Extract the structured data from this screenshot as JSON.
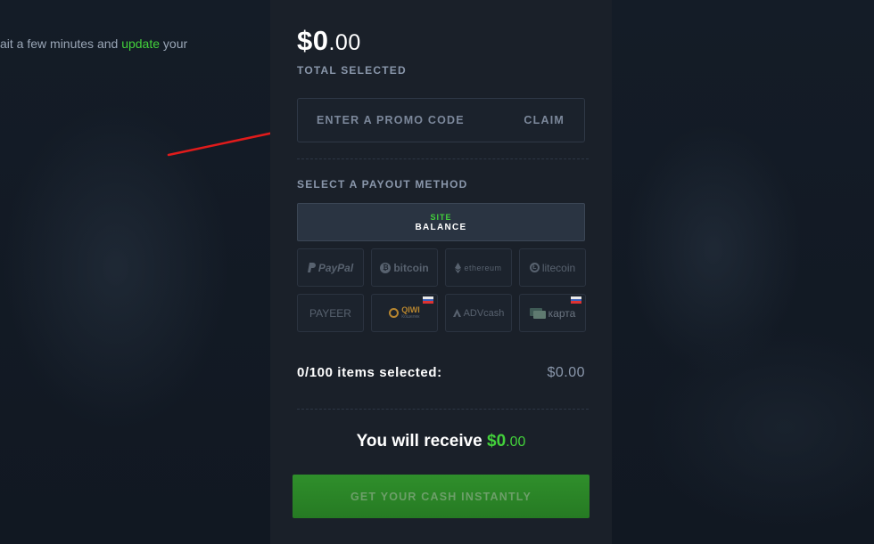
{
  "notice": {
    "before": "ait a few minutes and ",
    "link": "update",
    "after": " your"
  },
  "summary": {
    "amount_dollars": "$0",
    "amount_cents": ".00",
    "total_label": "TOTAL SELECTED"
  },
  "promo": {
    "placeholder": "ENTER A PROMO CODE",
    "value": "",
    "claim_label": "CLAIM"
  },
  "payout": {
    "label": "SELECT A PAYOUT METHOD",
    "site_balance": {
      "line1": "SITE",
      "line2": "BALANCE"
    },
    "methods": [
      {
        "name": "PayPal",
        "icon": "paypal-icon"
      },
      {
        "name": "bitcoin",
        "icon": "bitcoin-icon"
      },
      {
        "name": "ethereum",
        "icon": "ethereum-icon"
      },
      {
        "name": "litecoin",
        "icon": "litecoin-icon"
      },
      {
        "name": "PAYEER",
        "icon": "payeer-icon"
      },
      {
        "name": "QIWI",
        "sub": "Кошелек",
        "icon": "qiwi-icon",
        "flag": "ru-flag-icon"
      },
      {
        "name": "ADVcash",
        "icon": "advcash-icon"
      },
      {
        "name": "карта",
        "icon": "card-icon",
        "flag": "ru-flag-icon"
      }
    ]
  },
  "selection": {
    "items_text": "0/100 items selected:",
    "value": "$0.00"
  },
  "receive": {
    "prefix": "You will receive ",
    "amount_dollars": "$0",
    "amount_cents": ".00"
  },
  "cta": {
    "label": "GET YOUR CASH INSTANTLY"
  },
  "colors": {
    "accent_green": "#43d13b",
    "panel_bg": "#1a2029",
    "annotation_arrow": "#e01b1b"
  }
}
